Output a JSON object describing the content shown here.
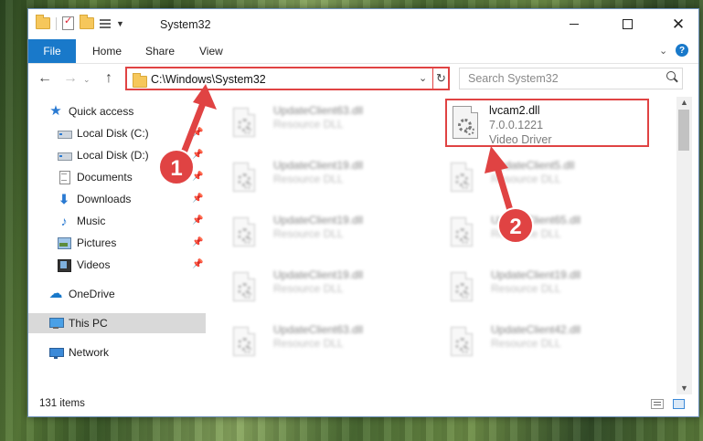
{
  "window": {
    "title": "System32",
    "controls": {
      "minimize_icon": "minimize-icon",
      "maximize_icon": "maximize-icon",
      "close_icon": "close-icon"
    }
  },
  "ribbon": {
    "tabs": [
      "File",
      "Home",
      "Share",
      "View"
    ],
    "help": "?"
  },
  "address": {
    "path": "C:\\Windows\\System32",
    "search_placeholder": "Search System32"
  },
  "sidebar": {
    "items": [
      {
        "label": "Quick access",
        "icon": "star-icon",
        "pinned": false
      },
      {
        "label": "Local Disk (C:)",
        "icon": "drive-icon",
        "pinned": true
      },
      {
        "label": "Local Disk (D:)",
        "icon": "drive-icon",
        "pinned": true
      },
      {
        "label": "Documents",
        "icon": "documents-icon",
        "pinned": true
      },
      {
        "label": "Downloads",
        "icon": "downloads-icon",
        "pinned": true
      },
      {
        "label": "Music",
        "icon": "music-icon",
        "pinned": true
      },
      {
        "label": "Pictures",
        "icon": "pictures-icon",
        "pinned": true
      },
      {
        "label": "Videos",
        "icon": "videos-icon",
        "pinned": true
      },
      {
        "label": "OneDrive",
        "icon": "onedrive-icon",
        "pinned": false
      },
      {
        "label": "This PC",
        "icon": "this-pc-icon",
        "pinned": false,
        "selected": true
      },
      {
        "label": "Network",
        "icon": "network-icon",
        "pinned": false
      }
    ]
  },
  "files": {
    "highlighted": {
      "name": "lvcam2.dll",
      "version": "7.0.0.1221",
      "description": "Video Driver"
    },
    "blurred": [
      {
        "name": "UpdateClient63.dll",
        "description": "Resource DLL"
      },
      {
        "name": "UpdateClient19.dll",
        "description": "Resource DLL"
      },
      {
        "name": "UpdateClient5.dll",
        "description": "Resource DLL"
      },
      {
        "name": "UpdateClient19.dll",
        "description": "Resource DLL"
      },
      {
        "name": "UpdateClient65.dll",
        "description": "Resource DLL"
      },
      {
        "name": "UpdateClient19.dll",
        "description": "Resource DLL"
      },
      {
        "name": "UpdateClient19.dll",
        "description": "Resource DLL"
      },
      {
        "name": "UpdateClient63.dll",
        "description": "Resource DLL"
      },
      {
        "name": "UpdateClient42.dll",
        "description": "Resource DLL"
      }
    ]
  },
  "status": {
    "item_count": "131 items"
  },
  "annotations": {
    "step1": "1",
    "step2": "2",
    "color": "#e04343"
  }
}
